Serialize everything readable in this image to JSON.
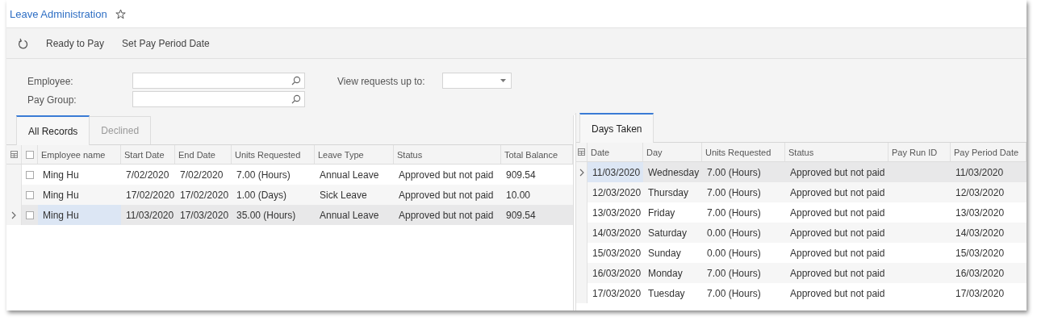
{
  "title": "Leave Administration",
  "toolbar": {
    "buttons": [
      "Ready to Pay",
      "Set Pay Period Date"
    ]
  },
  "filters": [
    {
      "label": "Employee:",
      "kind": "lookup"
    },
    {
      "label": "Pay Group:",
      "kind": "lookup"
    },
    {
      "label": "View requests up to:",
      "kind": "dropdown"
    }
  ],
  "left_tabs": [
    {
      "label": "All Records",
      "selected": true
    },
    {
      "label": "Declined",
      "selected": false
    }
  ],
  "records": {
    "columns": [
      "Employee name",
      "Start Date",
      "End Date",
      "Units Requested",
      "Leave Type",
      "Status",
      "Total Balance"
    ],
    "all_checked": false,
    "rows": [
      {
        "cells": [
          "Ming Hu",
          "7/02/2020",
          "7/02/2020",
          "7.00 (Hours)",
          "Annual Leave",
          "Approved but not paid",
          "909.54"
        ],
        "checked": false,
        "selected": false
      },
      {
        "cells": [
          "Ming Hu",
          "17/02/2020",
          "17/02/2020",
          "1.00 (Days)",
          "Sick Leave",
          "Approved but not paid",
          "10.00"
        ],
        "checked": false,
        "selected": false
      },
      {
        "cells": [
          "Ming Hu",
          "11/03/2020",
          "17/03/2020",
          "35.00 (Hours)",
          "Annual Leave",
          "Approved but not paid",
          "909.54"
        ],
        "checked": false,
        "selected": true
      }
    ]
  },
  "right_tabs": [
    {
      "label": "Days Taken",
      "selected": true
    }
  ],
  "days": {
    "columns": [
      "Date",
      "Day",
      "Units Requested",
      "Status",
      "Pay Run ID",
      "Pay Period Date"
    ],
    "rows": [
      {
        "cells": [
          "11/03/2020",
          "Wednesday",
          "7.00 (Hours)",
          "Approved but not paid",
          null,
          "11/03/2020"
        ],
        "selected": true
      },
      {
        "cells": [
          "12/03/2020",
          "Thursday",
          "7.00 (Hours)",
          "Approved but not paid",
          null,
          "12/03/2020"
        ],
        "selected": false
      },
      {
        "cells": [
          "13/03/2020",
          "Friday",
          "7.00 (Hours)",
          "Approved but not paid",
          null,
          "13/03/2020"
        ],
        "selected": false
      },
      {
        "cells": [
          "14/03/2020",
          "Saturday",
          "0.00 (Hours)",
          "Approved but not paid",
          null,
          "14/03/2020"
        ],
        "selected": false
      },
      {
        "cells": [
          "15/03/2020",
          "Sunday",
          "0.00 (Hours)",
          "Approved but not paid",
          null,
          "15/03/2020"
        ],
        "selected": false
      },
      {
        "cells": [
          "16/03/2020",
          "Monday",
          "7.00 (Hours)",
          "Approved but not paid",
          null,
          "16/03/2020"
        ],
        "selected": false
      },
      {
        "cells": [
          "17/03/2020",
          "Tuesday",
          "7.00 (Hours)",
          "Approved but not paid",
          null,
          "17/03/2020"
        ],
        "selected": false
      }
    ]
  }
}
